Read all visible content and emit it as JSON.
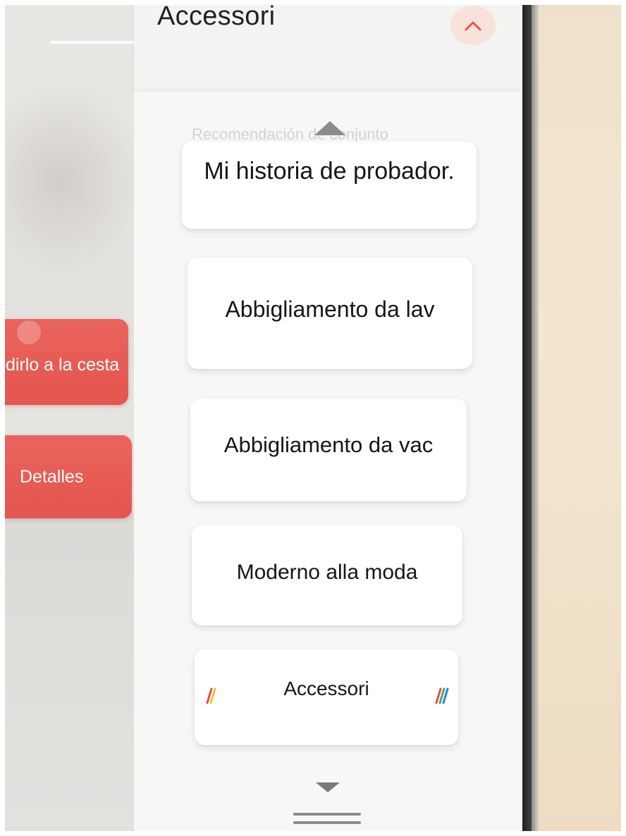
{
  "header": {
    "title": "Accessori"
  },
  "side_buttons": {
    "add_to_cart": "dirlo a la cesta",
    "details": "Detalles"
  },
  "background_hint": "Recomendación de conjunto",
  "menu": {
    "options": [
      {
        "label": "Mi historia de probador."
      },
      {
        "label": "Abbigliamento da lav"
      },
      {
        "label": "Abbigliamento da vac"
      },
      {
        "label": "Moderno alla moda"
      },
      {
        "label": "Accessori",
        "selected": true
      }
    ]
  },
  "colors": {
    "accent_red": "#e4554e",
    "collapse_button_bg": "#f7e2dc",
    "selection_marker_colors": [
      "#e84c3d",
      "#f2c230",
      "#3fae5a",
      "#3a7bd5"
    ]
  },
  "icons": {
    "collapse": "chevron-up-icon",
    "scroll_up": "triangle-up-icon",
    "scroll_down": "triangle-down-icon",
    "selection_marker": "rainbow-slash-icon",
    "drag_handle": "drag-handle-icon"
  }
}
